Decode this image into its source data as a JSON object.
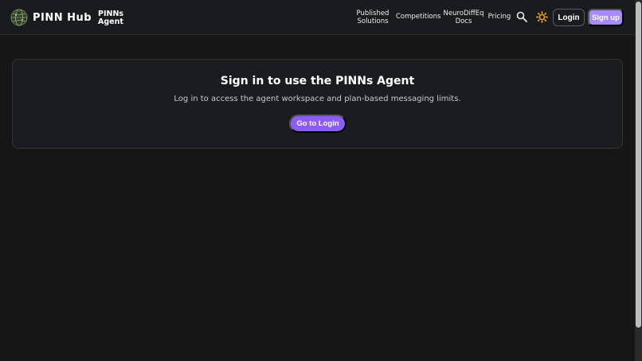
{
  "navbar": {
    "brand": "PINN Hub",
    "agent_line1": "PINNs",
    "agent_line2": "Agent",
    "links": {
      "published_line1": "Published",
      "published_line2": "Solutions",
      "competitions": "Competitions",
      "neuro_line1": "NeuroDiffEq",
      "neuro_line2": "Docs",
      "pricing": "Pricing"
    },
    "icons": [
      "search-icon",
      "sun-icon",
      "globe-logo-icon"
    ],
    "login": "Login",
    "signup": "Sign up"
  },
  "card": {
    "title": "Sign in to use the PINNs Agent",
    "text": "Log in to access the agent workspace and plan-based messaging limits.",
    "button": "Go to Login"
  },
  "colors": {
    "background": "#161616",
    "navbar": "#1a1b1f",
    "accent": "#8b5cf6",
    "signup": "#a78bfa",
    "theme_icon": "#f5a524"
  }
}
